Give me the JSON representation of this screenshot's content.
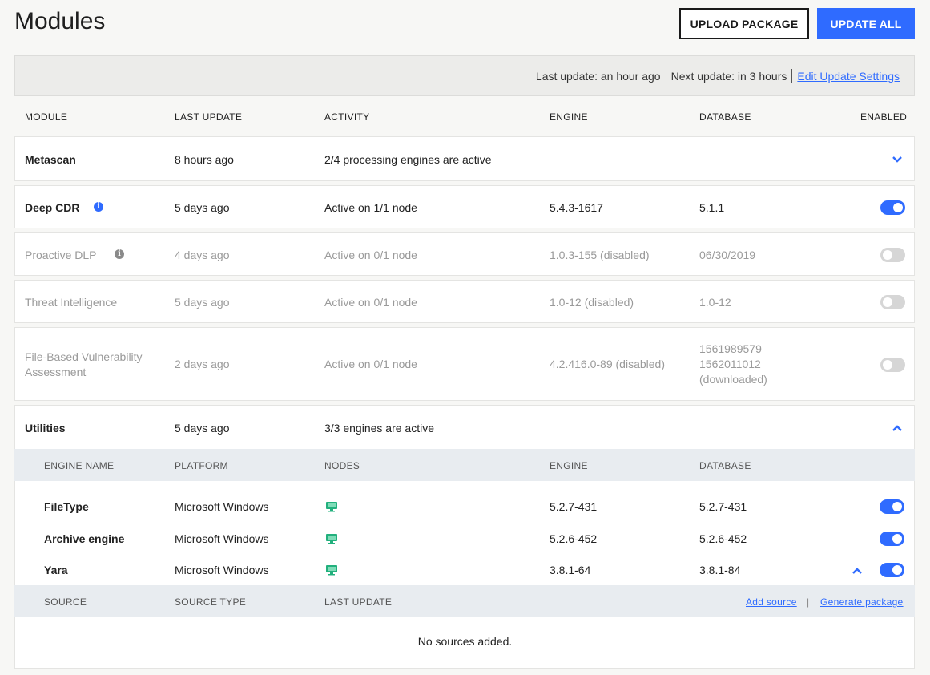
{
  "page": {
    "title": "Modules"
  },
  "actions": {
    "upload_label": "UPLOAD PACKAGE",
    "update_all_label": "UPDATE ALL"
  },
  "status": {
    "last_update": "Last update: an hour ago",
    "next_update": "Next update: in 3 hours",
    "edit_link": "Edit Update Settings"
  },
  "table": {
    "headers": [
      "MODULE",
      "LAST UPDATE",
      "ACTIVITY",
      "ENGINE",
      "DATABASE",
      "ENABLED"
    ],
    "rows": [
      {
        "module": "Metascan",
        "last_update": "8 hours ago",
        "activity": "2/4 processing engines are active",
        "engine": "",
        "database": "",
        "enabled": null,
        "expandable": "collapsed"
      },
      {
        "module": "Deep CDR",
        "last_update": "5 days ago",
        "activity": "Active on 1/1 node",
        "engine": "5.4.3-1617",
        "database": "5.1.1",
        "enabled": true,
        "info": true
      },
      {
        "module": "Proactive DLP",
        "last_update": "4 days ago",
        "activity": "Active on 0/1 node",
        "engine": "1.0.3-155 (disabled)",
        "database": "06/30/2019",
        "enabled": false,
        "info": true
      },
      {
        "module": "Threat Intelligence",
        "last_update": "5 days ago",
        "activity": "Active on 0/1 node",
        "engine": "1.0-12 (disabled)",
        "database": "1.0-12",
        "enabled": false
      },
      {
        "module_line1": "File-Based Vulnerability",
        "module_line2": "Assessment",
        "last_update": "2 days ago",
        "activity": "Active on 0/1 node",
        "engine": "4.2.416.0-89 (disabled)",
        "database_lines": [
          "1561989579",
          "1562011012",
          "(downloaded)"
        ],
        "enabled": false
      },
      {
        "module": "Utilities",
        "last_update": "5 days ago",
        "activity": "3/3 engines are active",
        "expandable": "expanded"
      }
    ]
  },
  "utilities": {
    "headers": [
      "ENGINE NAME",
      "PLATFORM",
      "NODES",
      "ENGINE",
      "DATABASE"
    ],
    "engines": [
      {
        "name": "FileType",
        "platform": "Microsoft Windows",
        "engine": "5.2.7-431",
        "database": "5.2.7-431",
        "enabled": true
      },
      {
        "name": "Archive engine",
        "platform": "Microsoft Windows",
        "engine": "5.2.6-452",
        "database": "5.2.6-452",
        "enabled": true
      },
      {
        "name": "Yara",
        "platform": "Microsoft Windows",
        "engine": "3.8.1-64",
        "database": "3.8.1-84",
        "enabled": true,
        "expanded": true
      }
    ],
    "sources": {
      "headers": [
        "SOURCE",
        "SOURCE TYPE",
        "LAST UPDATE"
      ],
      "add_source": "Add source",
      "separator": "|",
      "generate_package": "Generate package",
      "empty": "No sources added."
    }
  },
  "colors": {
    "accent": "#2f6bff",
    "node_icon": "#22b07d",
    "muted_text": "#9a9a9a"
  }
}
